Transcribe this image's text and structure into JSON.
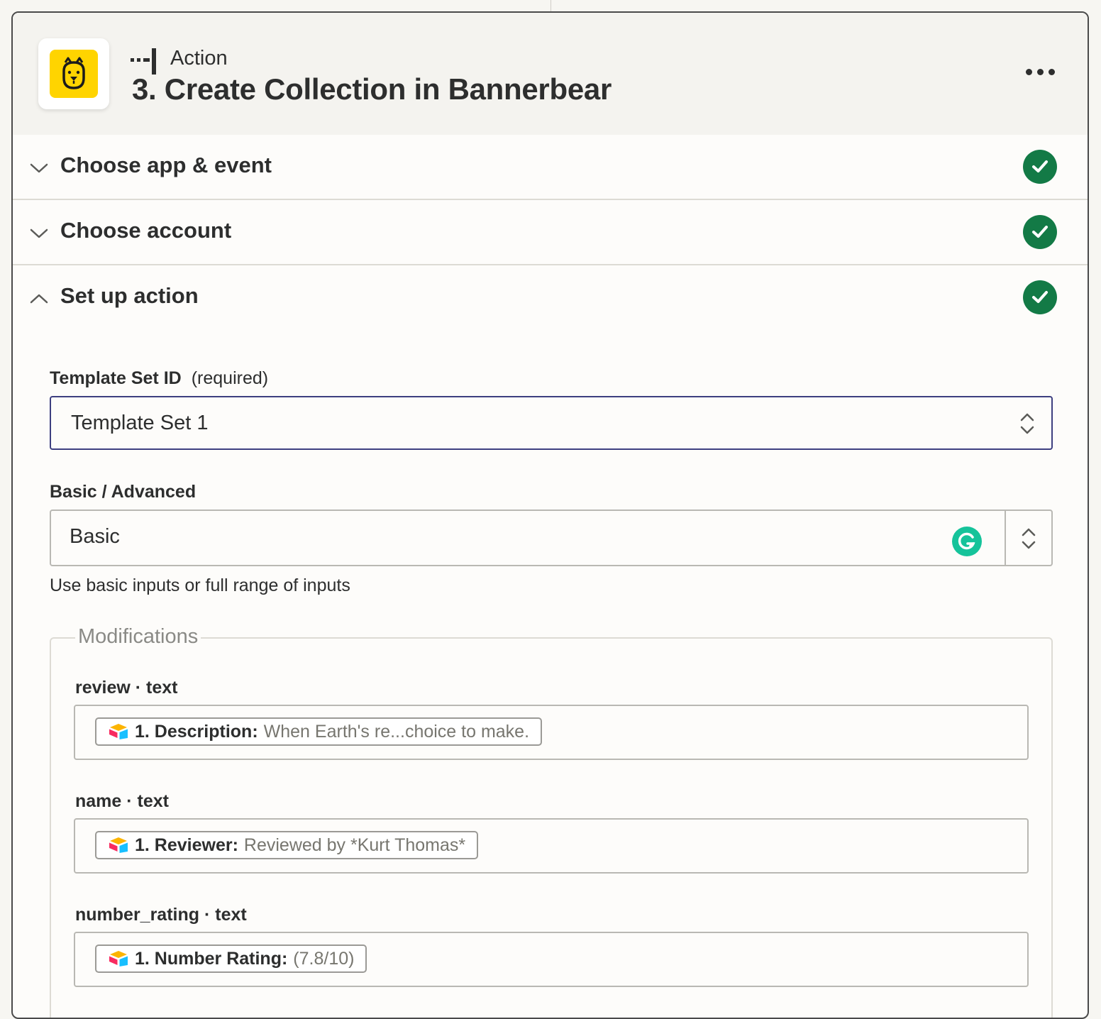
{
  "header": {
    "step_kind": "Action",
    "step_title": "3. Create Collection in Bannerbear"
  },
  "sections": [
    {
      "label": "Choose app & event",
      "status": "complete"
    },
    {
      "label": "Choose account",
      "status": "complete"
    },
    {
      "label": "Set up action",
      "status": "complete",
      "expanded": true
    }
  ],
  "form": {
    "template_set": {
      "label": "Template Set ID",
      "required_text": "(required)",
      "value": "Template Set 1"
    },
    "mode": {
      "label": "Basic / Advanced",
      "value": "Basic",
      "help": "Use basic inputs or full range of inputs"
    },
    "modifications": {
      "legend": "Modifications",
      "fields": [
        {
          "label": "review · text",
          "pill_key": "1. Description:",
          "pill_value": "When Earth's re...choice to make."
        },
        {
          "label": "name · text",
          "pill_key": "1. Reviewer:",
          "pill_value": "Reviewed by *Kurt Thomas*"
        },
        {
          "label": "number_rating · text",
          "pill_key": "1. Number Rating:",
          "pill_value": "(7.8/10)"
        }
      ]
    }
  },
  "colors": {
    "success_green": "#137a46",
    "bannerbear_yellow": "#ffd400",
    "grammarly_green": "#15c39a",
    "focus_border": "#3d3f80"
  },
  "icons": [
    "bannerbear-logo-icon",
    "step-connector-icon",
    "more-options-icon",
    "chevron-down-icon",
    "chevron-up-icon",
    "check-icon",
    "updown-icon",
    "grammarly-icon",
    "airtable-icon"
  ]
}
